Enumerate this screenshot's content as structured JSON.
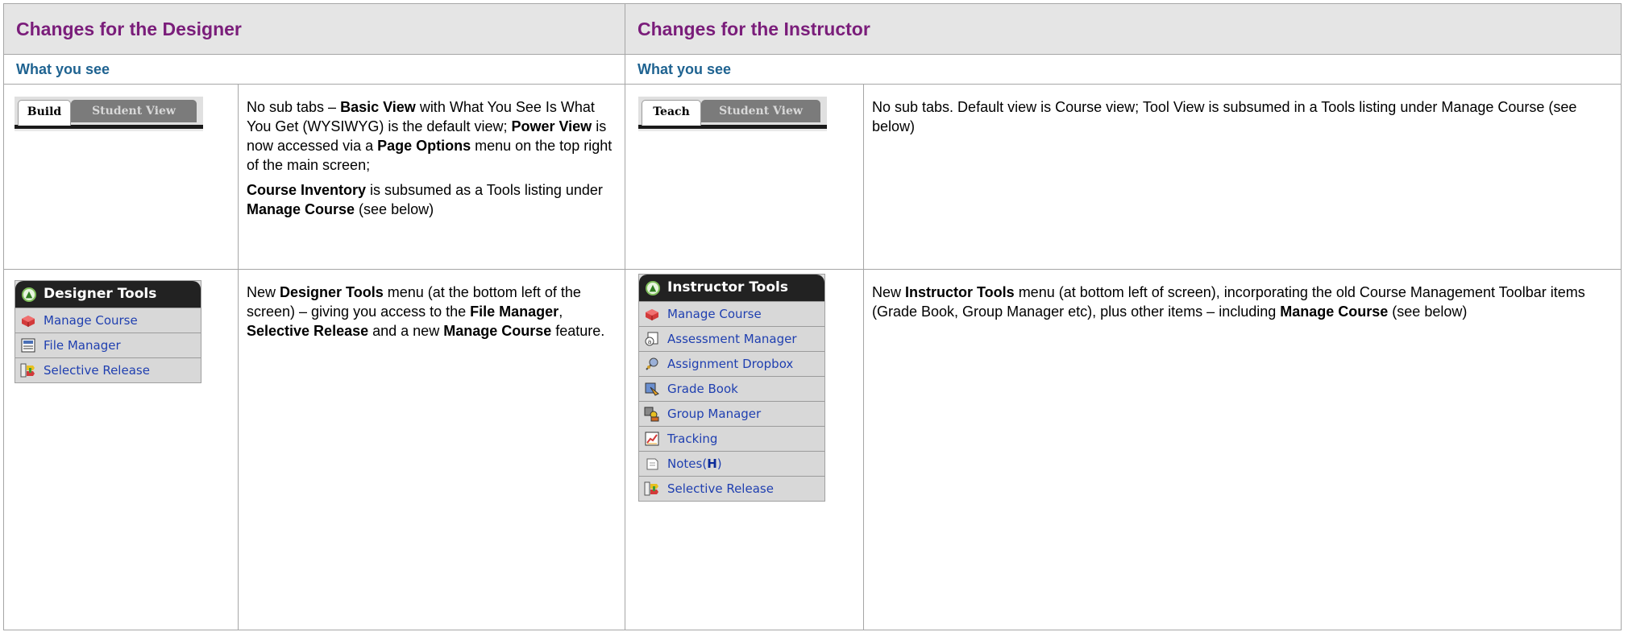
{
  "designer": {
    "header": "Changes for the Designer",
    "subheader": "What you see",
    "tabs": {
      "active": "Build",
      "inactive": "Student View"
    },
    "row1": {
      "p1_a": "No sub tabs – ",
      "p1_b": "Basic View",
      "p1_c": " with What You See Is What You Get (WYSIWYG) is the default view; ",
      "p1_d": "Power View",
      "p1_e": " is now accessed via a ",
      "p1_f": "Page Options",
      "p1_g": " menu on the top right of the main screen;",
      "p2_a": "Course Inventory",
      "p2_b": " is subsumed as a Tools listing under ",
      "p2_c": "Manage Course",
      "p2_d": " (see below)"
    },
    "menu": {
      "title": "Designer Tools",
      "items": [
        "Manage Course",
        "File Manager",
        "Selective Release"
      ]
    },
    "row2": {
      "a": "New ",
      "b": "Designer Tools",
      "c": " menu (at the bottom left of the screen) – giving you access to the ",
      "d": "File Manager",
      "e": ", ",
      "f": "Selective Release",
      "g": " and a new ",
      "h": "Manage Course",
      "i": " feature."
    }
  },
  "instructor": {
    "header": "Changes for the Instructor",
    "subheader": "What you see",
    "tabs": {
      "active": "Teach",
      "inactive": "Student View"
    },
    "row1": {
      "text": "No sub tabs. Default view is Course view; Tool View is subsumed in a Tools listing under Manage Course (see below)"
    },
    "menu": {
      "title": "Instructor Tools",
      "items": [
        "Manage Course",
        "Assessment Manager",
        "Assignment Dropbox",
        "Grade Book",
        "Group Manager",
        "Tracking",
        "Notes(",
        "H",
        ")",
        "Selective Release"
      ]
    },
    "row2": {
      "a": "New ",
      "b": "Instructor Tools",
      "c": " menu (at bottom left of screen), incorporating the old Course Management Toolbar items (Grade Book, Group Manager etc), plus other items – including ",
      "d": "Manage Course",
      "e": " (see below)"
    }
  },
  "colors": {
    "header_text": "#7a1d7a",
    "subheader_text": "#1f6391",
    "header_bg": "#e5e5e5",
    "menu_link": "#1f3fb0"
  }
}
